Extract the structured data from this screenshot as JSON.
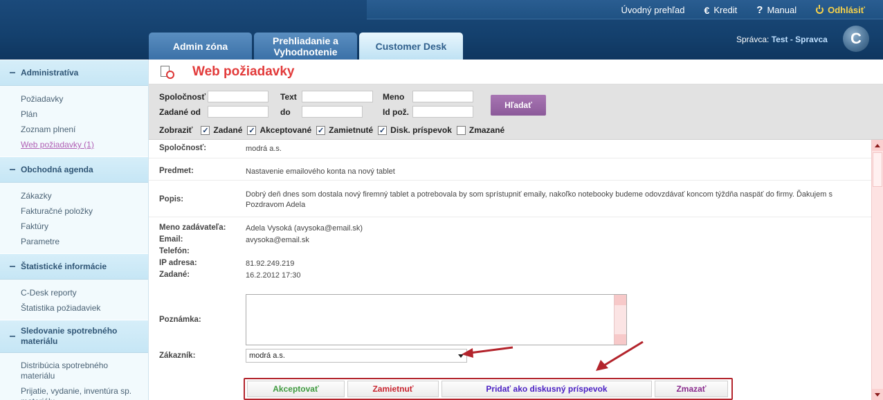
{
  "topnav": {
    "overview": "Úvodný prehľad",
    "credit": "Kredit",
    "manual": "Manual",
    "logout": "Odhlásiť"
  },
  "tabs": [
    {
      "label": "Admin zóna"
    },
    {
      "label": "Prehliadanie a Vyhodnotenie"
    },
    {
      "label": "Customer Desk"
    }
  ],
  "admin": {
    "prefix": "Správca:",
    "name": "Test - Spravca"
  },
  "logo": {
    "letter": "C"
  },
  "sidebar": {
    "sections": [
      {
        "title": "Administratíva",
        "items": [
          "Požiadavky",
          "Plán",
          "Zoznam plnení",
          "Web požiadavky (1)"
        ]
      },
      {
        "title": "Obchodná agenda",
        "items": [
          "Zákazky",
          "Fakturačné položky",
          "Faktúry",
          "Parametre"
        ]
      },
      {
        "title": "Štatistické informácie",
        "items": [
          "C-Desk reporty",
          "Štatistika požiadaviek"
        ]
      },
      {
        "title": "Sledovanie spotrebného materiálu",
        "items": [
          "Distribúcia spotrebného materiálu",
          "Prijatie, vydanie, inventúra sp. materiálu"
        ]
      }
    ]
  },
  "page": {
    "title": "Web požiadavky"
  },
  "filter": {
    "company_label": "Spoločnosť",
    "text_label": "Text",
    "name_label": "Meno",
    "from_label": "Zadané od",
    "to_label": "do",
    "id_label": "Id pož.",
    "search_label": "Hľadať",
    "show_label": "Zobraziť",
    "checks": [
      {
        "label": "Zadané",
        "checked": true
      },
      {
        "label": "Akceptované",
        "checked": true
      },
      {
        "label": "Zamietnuté",
        "checked": true
      },
      {
        "label": "Disk. príspevok",
        "checked": true
      },
      {
        "label": "Zmazané",
        "checked": false
      }
    ]
  },
  "detail": {
    "company_label": "Spoločnosť:",
    "company": "modrá a.s.",
    "subject_label": "Predmet:",
    "subject": "Nastavenie emailového konta na nový tablet",
    "desc_label": "Popis:",
    "desc": "Dobrý deň dnes som dostala nový firemný tablet a potrebovala by som sprístupniť emaily, nakoľko notebooky budeme odovzdávať koncom týždňa naspäť do firmy. Ďakujem s Pozdravom Adela",
    "requester_label": "Meno zadávateľa:",
    "requester": "Adela Vysoká (avysoka@email.sk)",
    "email_label": "Email:",
    "email": "avysoka@email.sk",
    "phone_label": "Telefón:",
    "phone": "",
    "ip_label": "IP adresa:",
    "ip": "81.92.249.219",
    "created_label": "Zadané:",
    "created": "16.2.2012 17:30",
    "note_label": "Poznámka:",
    "customer_label": "Zákazník:",
    "customer_selected": "modrá a.s."
  },
  "actions": {
    "accept": "Akceptovať",
    "reject": "Zamietnuť",
    "discussion": "Pridať ako diskusný príspevok",
    "delete": "Zmazať"
  },
  "colors": {
    "header": "#14406d",
    "title": "#e23a3a",
    "search_button": "#9a68a6",
    "accept": "#3f9a3f",
    "reject": "#c8242f",
    "discussion": "#4b20c4",
    "delete": "#8a2b8d",
    "annotation": "#b3242c"
  }
}
